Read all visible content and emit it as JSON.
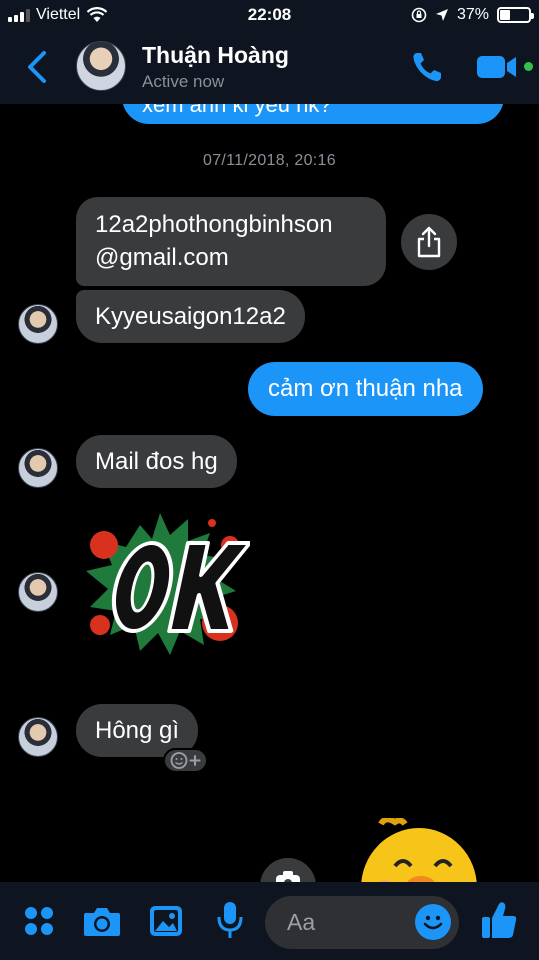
{
  "status_bar": {
    "carrier": "Viettel",
    "time": "22:08",
    "battery_percent": "37%",
    "battery_level": 0.37
  },
  "header": {
    "contact_name": "Thuận Hoàng",
    "contact_status": "Active now"
  },
  "conversation": {
    "partial_sent_text": "xem anh kỉ yêu nk?",
    "timestamp": "07/11/2018, 20:16",
    "messages": [
      {
        "from": "them",
        "lines": [
          "12a2phothongbinhson",
          "@gmail.com"
        ]
      },
      {
        "from": "them",
        "text": "Kyyeusaigon12a2"
      },
      {
        "from": "me",
        "text": "cảm ơn thuận nha"
      },
      {
        "from": "them",
        "text": "Mail đos hg"
      },
      {
        "from": "them",
        "sticker": "ok-sticker"
      },
      {
        "from": "them",
        "text": "Hông gì"
      }
    ]
  },
  "composer": {
    "placeholder": "Aa"
  },
  "colors": {
    "accent": "#1b95f8",
    "incoming_bubble": "#3a3b3d",
    "online": "#31c24d"
  }
}
